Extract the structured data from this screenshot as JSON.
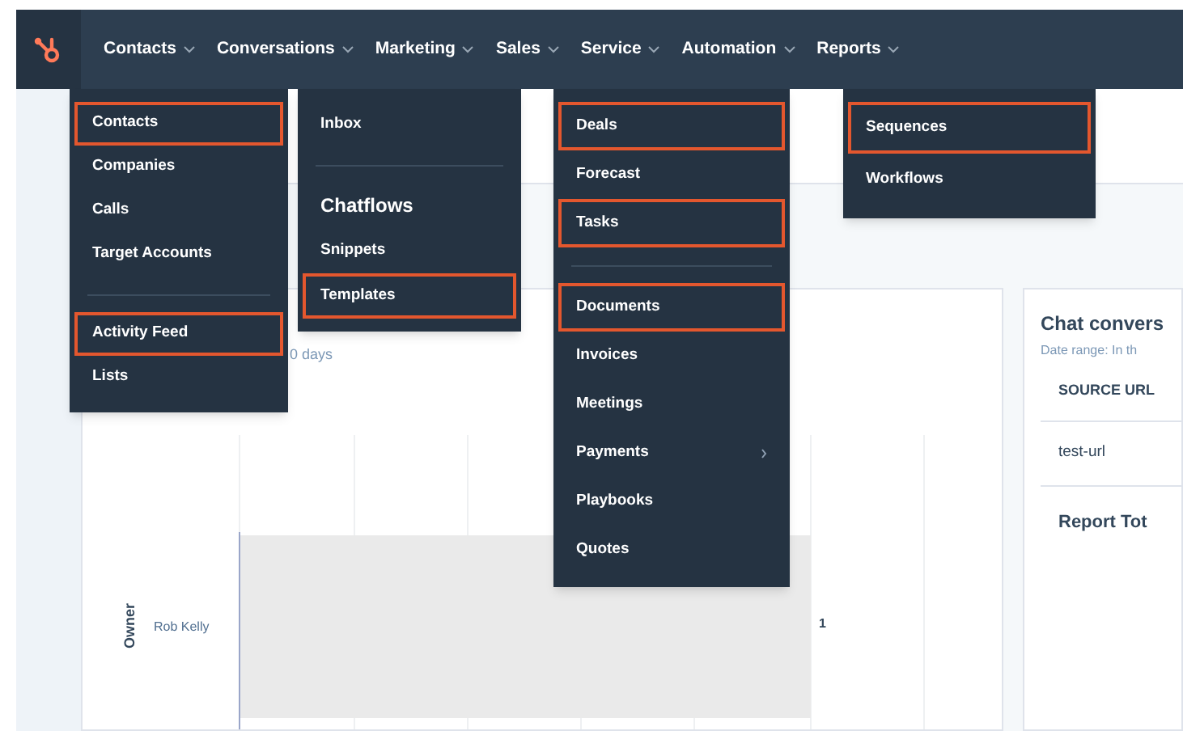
{
  "nav": {
    "items": [
      {
        "label": "Contacts"
      },
      {
        "label": "Conversations"
      },
      {
        "label": "Marketing"
      },
      {
        "label": "Sales"
      },
      {
        "label": "Service"
      },
      {
        "label": "Automation"
      },
      {
        "label": "Reports"
      }
    ]
  },
  "menus": [
    {
      "items": [
        {
          "kind": "item",
          "label": "Contacts",
          "highlighted": true
        },
        {
          "kind": "item",
          "label": "Companies",
          "highlighted": false
        },
        {
          "kind": "item",
          "label": "Calls",
          "highlighted": false
        },
        {
          "kind": "item",
          "label": "Target Accounts",
          "highlighted": false
        },
        {
          "kind": "divider"
        },
        {
          "kind": "item",
          "label": "Activity Feed",
          "highlighted": true
        },
        {
          "kind": "item",
          "label": "Lists",
          "highlighted": false
        }
      ]
    },
    {
      "items": [
        {
          "kind": "item",
          "label": "Inbox",
          "highlighted": false
        },
        {
          "kind": "divider"
        },
        {
          "kind": "heading",
          "label": "Chatflows",
          "highlighted": false
        },
        {
          "kind": "item",
          "label": "Snippets",
          "highlighted": false
        },
        {
          "kind": "item",
          "label": "Templates",
          "highlighted": true
        }
      ]
    },
    {
      "items": [
        {
          "kind": "item",
          "label": "Deals",
          "highlighted": true
        },
        {
          "kind": "item",
          "label": "Forecast",
          "highlighted": false
        },
        {
          "kind": "item",
          "label": "Tasks",
          "highlighted": true
        },
        {
          "kind": "divider"
        },
        {
          "kind": "item",
          "label": "Documents",
          "highlighted": true
        },
        {
          "kind": "item",
          "label": "Invoices",
          "highlighted": false
        },
        {
          "kind": "item",
          "label": "Meetings",
          "highlighted": false
        },
        {
          "kind": "item",
          "label": "Payments",
          "highlighted": false,
          "submenu": true
        },
        {
          "kind": "item",
          "label": "Playbooks",
          "highlighted": false
        },
        {
          "kind": "item",
          "label": "Quotes",
          "highlighted": false
        }
      ]
    },
    {
      "items": [
        {
          "kind": "item",
          "label": "Sequences",
          "highlighted": true
        },
        {
          "kind": "item",
          "label": "Workflows",
          "highlighted": false
        }
      ]
    }
  ],
  "chart_card": {
    "date_range": "0 days",
    "axis_title": "Owner",
    "category_label": "Rob Kelly",
    "value_label": "1"
  },
  "table_card": {
    "title": "Chat convers",
    "date_range": "Date range: In th",
    "columns": [
      "SOURCE URL"
    ],
    "rows": [
      [
        "test-url"
      ]
    ],
    "total_label": "Report Tot"
  }
}
